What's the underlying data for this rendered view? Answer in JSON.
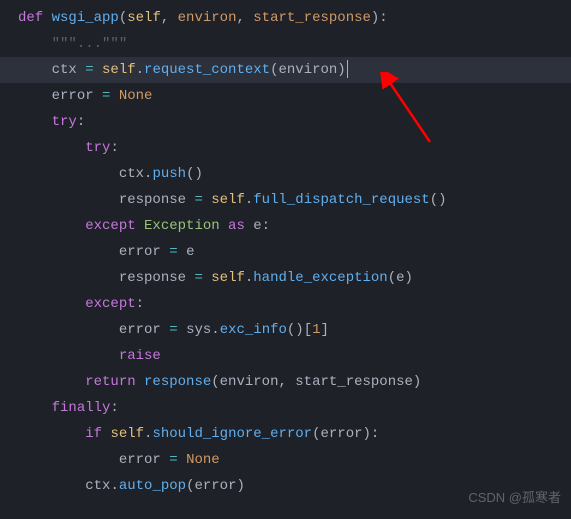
{
  "code": {
    "l1": {
      "def": "def ",
      "fn": "wsgi_app",
      "open": "(",
      "self": "self",
      "c1": ", ",
      "p1": "environ",
      "c2": ", ",
      "p2": "start_response",
      "close": "):"
    },
    "l2": {
      "indent": "    ",
      "doc": "\"\"\"...\"\"\""
    },
    "l3": {
      "indent": "    ",
      "v": "ctx ",
      "op": "= ",
      "self": "self",
      "dot": ".",
      "fn": "request_context",
      "open": "(",
      "arg": "environ",
      "close": ")"
    },
    "l4": {
      "indent": "    ",
      "v": "error ",
      "op": "= ",
      "val": "None"
    },
    "l5": {
      "indent": "    ",
      "kw": "try",
      "colon": ":"
    },
    "l6": {
      "indent": "        ",
      "kw": "try",
      "colon": ":"
    },
    "l7": {
      "indent": "            ",
      "v": "ctx",
      "dot": ".",
      "fn": "push",
      "parens": "()"
    },
    "l8": {
      "indent": "            ",
      "v": "response ",
      "op": "= ",
      "self": "self",
      "dot": ".",
      "fn": "full_dispatch_request",
      "parens": "()"
    },
    "l9": {
      "indent": "        ",
      "kw": "except ",
      "cls": "Exception ",
      "as": "as ",
      "e": "e",
      "colon": ":"
    },
    "l10": {
      "indent": "            ",
      "v": "error ",
      "op": "= ",
      "e": "e"
    },
    "l11": {
      "indent": "            ",
      "v": "response ",
      "op": "= ",
      "self": "self",
      "dot": ".",
      "fn": "handle_exception",
      "open": "(",
      "arg": "e",
      "close": ")"
    },
    "l12": {
      "indent": "        ",
      "kw": "except",
      "colon": ":"
    },
    "l13": {
      "indent": "            ",
      "v": "error ",
      "op": "= ",
      "mod": "sys",
      "dot": ".",
      "fn": "exc_info",
      "parens": "()[",
      "idx": "1",
      "close": "]"
    },
    "l14": {
      "indent": "            ",
      "kw": "raise"
    },
    "l15": {
      "indent": "        ",
      "kw": "return ",
      "fn": "response",
      "open": "(",
      "a1": "environ",
      "c": ", ",
      "a2": "start_response",
      "close": ")"
    },
    "l16": {
      "indent": "    ",
      "kw": "finally",
      "colon": ":"
    },
    "l17": {
      "indent": "        ",
      "kw": "if ",
      "self": "self",
      "dot": ".",
      "fn": "should_ignore_error",
      "open": "(",
      "arg": "error",
      "close": "):"
    },
    "l18": {
      "indent": "            ",
      "v": "error ",
      "op": "= ",
      "val": "None"
    },
    "l19": {
      "indent": "        ",
      "v": "ctx",
      "dot": ".",
      "fn": "auto_pop",
      "open": "(",
      "arg": "error",
      "close": ")"
    }
  },
  "watermark": "CSDN @孤寒者"
}
